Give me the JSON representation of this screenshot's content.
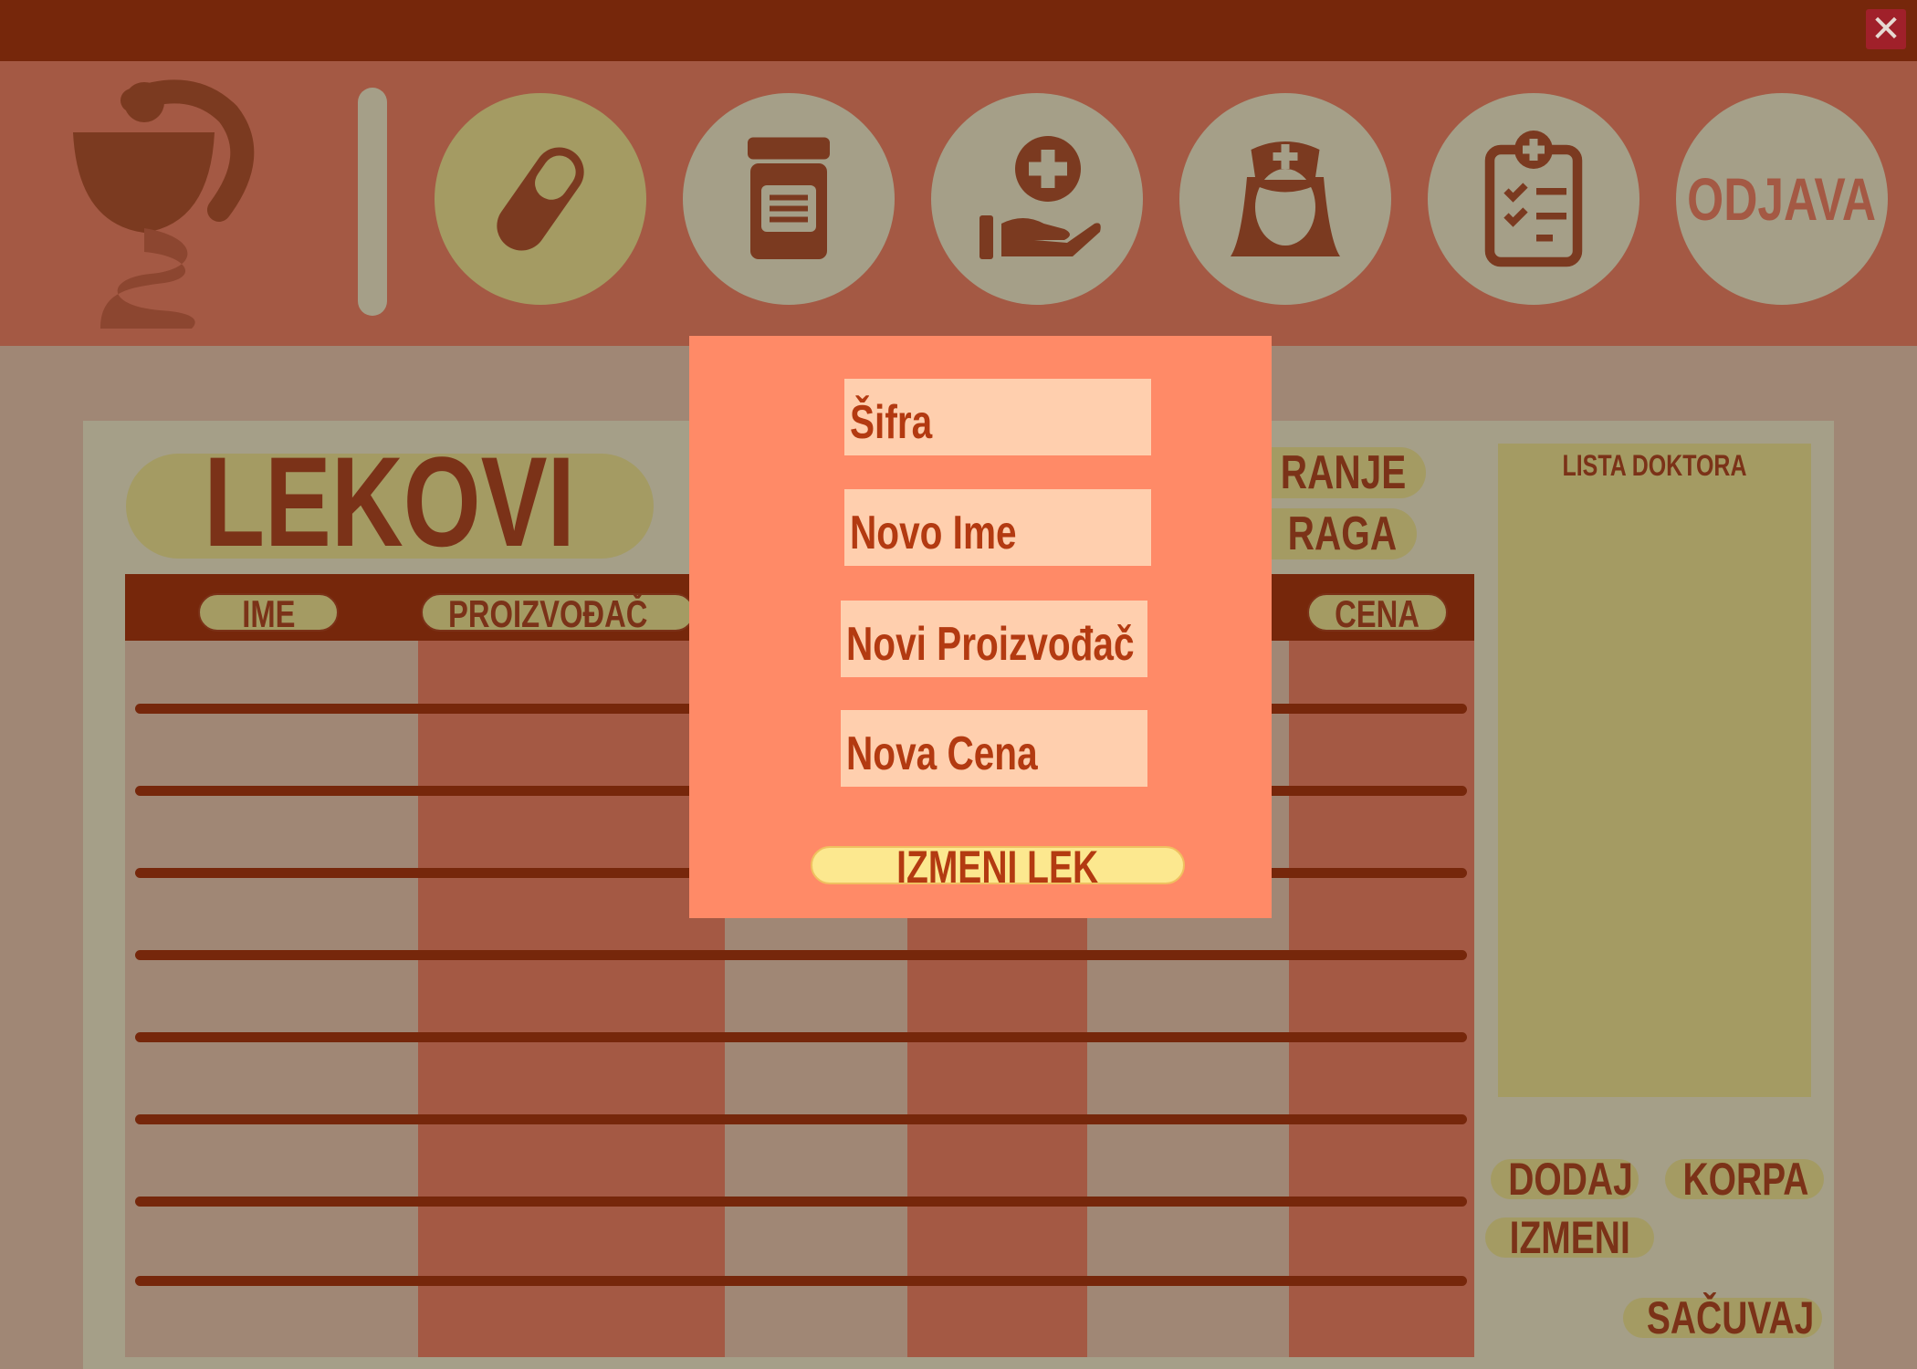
{
  "window": {
    "close_icon": "close-x-icon"
  },
  "nav": {
    "logo_icon": "bowl-of-hygieia-icon",
    "items": [
      {
        "icon": "pill-icon",
        "active": true
      },
      {
        "icon": "medicine-jar-icon",
        "active": false
      },
      {
        "icon": "hand-medical-cross-icon",
        "active": false
      },
      {
        "icon": "nurse-icon",
        "active": false
      },
      {
        "icon": "medical-clipboard-icon",
        "active": false
      }
    ],
    "logout_label": "ODJAVA"
  },
  "page": {
    "title": "LEKOVI",
    "sort_label": "RANJE",
    "search_label": "RAGA"
  },
  "table": {
    "headers": [
      "IME",
      "PROIZVOĐAČ",
      "CENA"
    ],
    "rows": 8
  },
  "doctors": {
    "title": "LISTA DOKTORA"
  },
  "actions": {
    "add": "DODAJ",
    "cart": "KORPA",
    "edit": "IZMENI",
    "save": "SAČUVAJ"
  },
  "modal": {
    "fields": {
      "code": "Šifra",
      "new_name": "Novo Ime",
      "new_manufacturer": "Novi Proizvođač",
      "new_price": "Nova Cena"
    },
    "submit_label": "IZMENI LEK"
  },
  "colors": {
    "titlebar": "#76270b",
    "navbar": "#a45944",
    "overlay_panel": "#a59f88",
    "accent_pill": "#a49b63",
    "modal_bg": "#ff8a67",
    "modal_field": "#ffcfae",
    "modal_button": "#fce88f",
    "text_dark": "#7b3218"
  }
}
